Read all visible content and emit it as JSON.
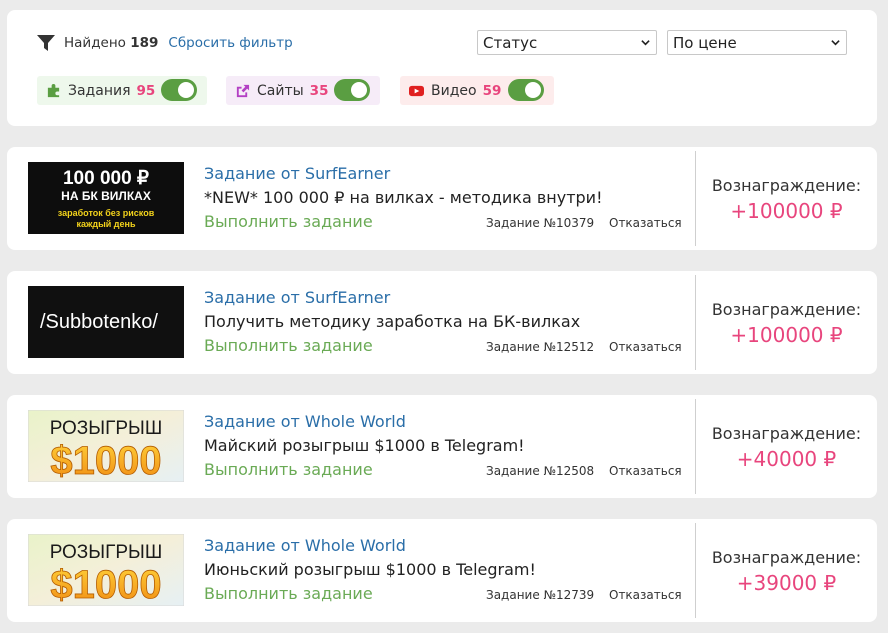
{
  "filter": {
    "found_label": "Найдено",
    "found_count": "189",
    "reset_label": "Сбросить фильтр",
    "status_select": "Статус",
    "sort_select": "По цене"
  },
  "chips": [
    {
      "label": "Задания",
      "count": "95",
      "icon": "puzzle-icon",
      "enabled": true,
      "bg": "#eef8ec",
      "icon_color": "#5a9e42"
    },
    {
      "label": "Сайты",
      "count": "35",
      "icon": "share-icon",
      "enabled": true,
      "bg": "#f6ecf8",
      "icon_color": "#b340c4"
    },
    {
      "label": "Видео",
      "count": "59",
      "icon": "youtube-icon",
      "enabled": true,
      "bg": "#fdecec",
      "icon_color": "#e02020"
    }
  ],
  "tasks": [
    {
      "author": "Задание от SurfEarner",
      "title": "*NEW* 100 000 ₽ на вилках - методика внутри!",
      "action": "Выполнить задание",
      "number": "Задание №10379",
      "refuse": "Отказаться",
      "reward_label": "Вознаграждение:",
      "reward": "+100000 ₽",
      "banner": {
        "line1": "100 000 ₽",
        "line2": "НА БК ВИЛКАХ",
        "line3": "заработок без рисков",
        "line4": "каждый день"
      }
    },
    {
      "author": "Задание от SurfEarner",
      "title": "Получить методику заработка на БК-вилках",
      "action": "Выполнить задание",
      "number": "Задание №12512",
      "refuse": "Отказаться",
      "reward_label": "Вознаграждение:",
      "reward": "+100000 ₽",
      "banner": {
        "text": "/Subbotenko/"
      }
    },
    {
      "author": "Задание от Whole World",
      "title": "Майский розыгрыш $1000 в Telegram!",
      "action": "Выполнить задание",
      "number": "Задание №12508",
      "refuse": "Отказаться",
      "reward_label": "Вознаграждение:",
      "reward": "+40000 ₽",
      "banner": {
        "line1": "РОЗЫГРЫШ",
        "line2": "$1000"
      }
    },
    {
      "author": "Задание от Whole World",
      "title": "Июньский розыгрыш $1000 в Telegram!",
      "action": "Выполнить задание",
      "number": "Задание №12739",
      "refuse": "Отказаться",
      "reward_label": "Вознаграждение:",
      "reward": "+39000 ₽",
      "banner": {
        "line1": "РОЗЫГРЫШ",
        "line2": "$1000"
      }
    }
  ],
  "colors": {
    "accent_pink": "#e8457d",
    "link_blue": "#2a6ea8",
    "action_green": "#6aaa55",
    "toggle_green": "#5a9e42"
  }
}
